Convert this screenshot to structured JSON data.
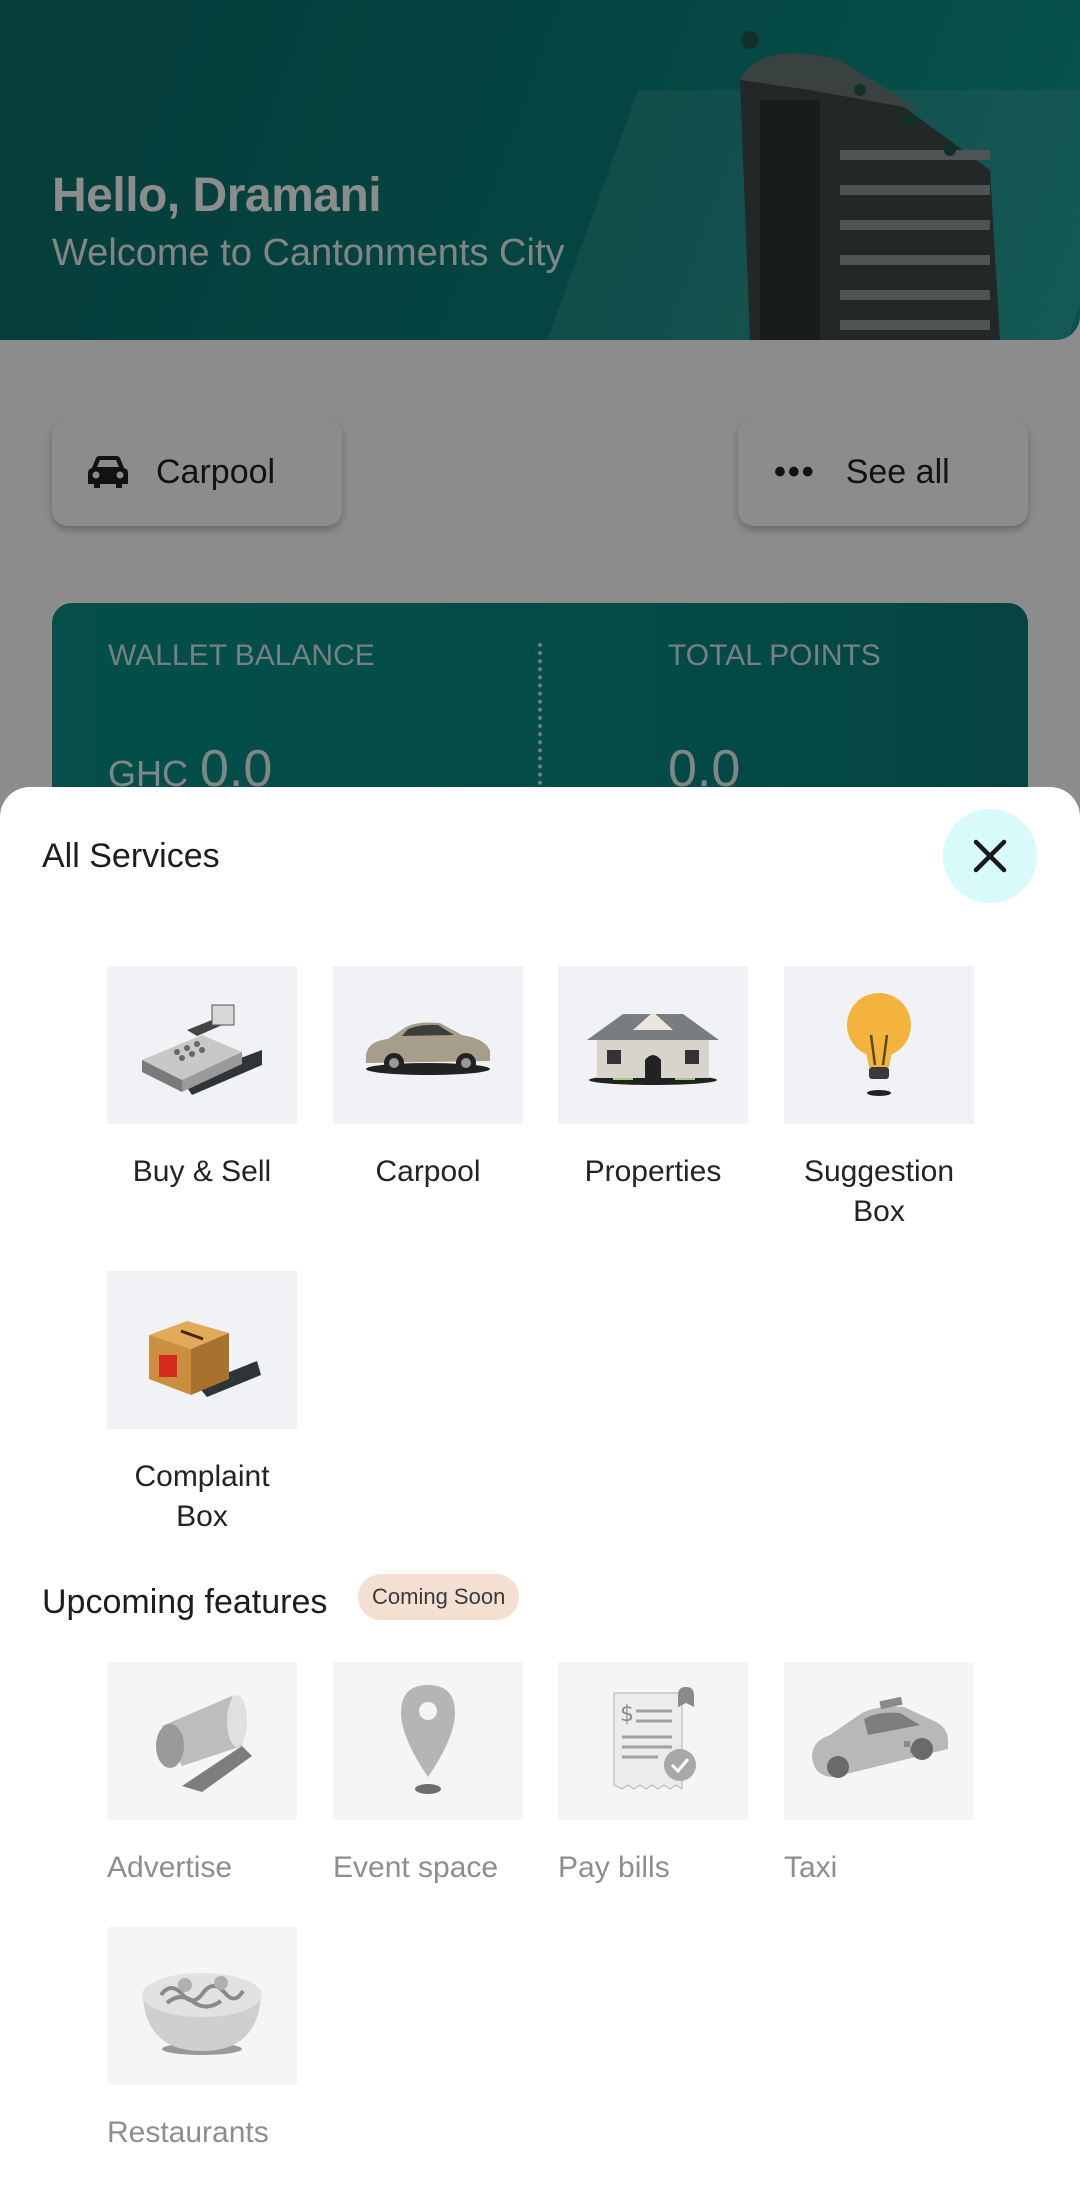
{
  "header": {
    "greeting": "Hello, Dramani",
    "welcome": "Welcome to Cantonments City"
  },
  "quick_actions": {
    "carpool_label": "Carpool",
    "see_all_label": "See all"
  },
  "wallet": {
    "balance_label": "WALLET BALANCE",
    "currency": "GHC",
    "balance_value": "0.0",
    "points_label": "TOTAL POINTS",
    "points_value": "0.0"
  },
  "sheet": {
    "title": "All Services",
    "services": [
      {
        "label": "Buy & Sell",
        "icon": "cash-register-icon"
      },
      {
        "label": "Carpool",
        "icon": "car-icon"
      },
      {
        "label": "Properties",
        "icon": "house-icon"
      },
      {
        "label": "Suggestion\nBox",
        "icon": "lightbulb-icon"
      },
      {
        "label": "Complaint\nBox",
        "icon": "complaint-box-icon"
      }
    ],
    "upcoming_title": "Upcoming features",
    "coming_soon_badge": "Coming Soon",
    "upcoming": [
      {
        "label": "Advertise",
        "icon": "megaphone-icon"
      },
      {
        "label": "Event space",
        "icon": "location-pin-icon"
      },
      {
        "label": "Pay bills",
        "icon": "bill-receipt-icon"
      },
      {
        "label": "Taxi",
        "icon": "taxi-icon"
      },
      {
        "label": "Restaurants",
        "icon": "food-bowl-icon"
      }
    ]
  },
  "colors": {
    "brand_teal": "#097f79",
    "close_button_bg": "#d8fafa",
    "badge_bg": "#f4e0d2"
  }
}
